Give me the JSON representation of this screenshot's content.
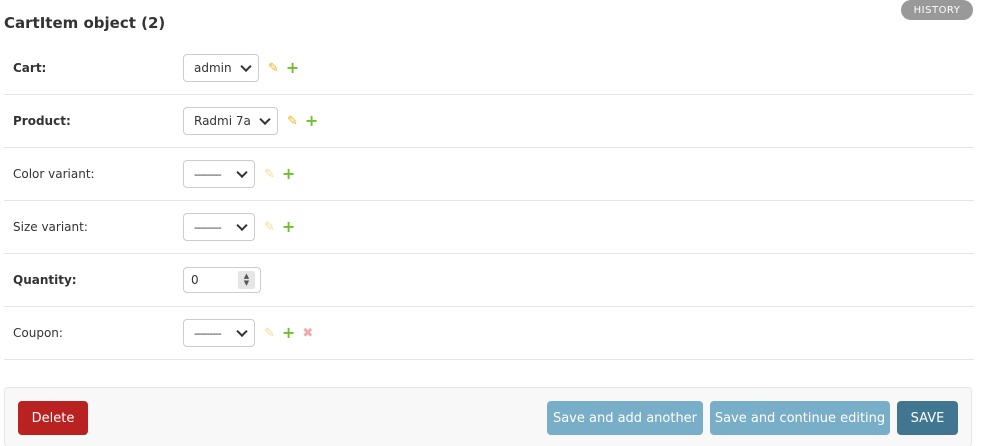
{
  "page": {
    "title": "CartItem object (2)",
    "history_label": "HISTORY"
  },
  "fields": {
    "cart": {
      "label": "Cart:",
      "value": "admin"
    },
    "product": {
      "label": "Product:",
      "value": "Radmi 7a"
    },
    "color_variant": {
      "label": "Color variant:",
      "value": "---------"
    },
    "size_variant": {
      "label": "Size variant:",
      "value": "---------"
    },
    "quantity": {
      "label": "Quantity:",
      "value": "0"
    },
    "coupon": {
      "label": "Coupon:",
      "value": "---------"
    }
  },
  "icons": {
    "pencil": "✎",
    "plus": "+",
    "delete": "✖",
    "spin_up": "▲",
    "spin_down": "▼"
  },
  "actions": {
    "delete": "Delete",
    "save_add_another": "Save and add another",
    "save_continue": "Save and continue editing",
    "save": "SAVE"
  },
  "colors": {
    "delete_button": "#ba2121",
    "secondary_button": "#79aec8",
    "primary_button": "#417690",
    "edit_icon": "#e6b818",
    "add_icon": "#70bf2b",
    "remove_icon": "#f0a8a8",
    "history_button": "#999999"
  }
}
